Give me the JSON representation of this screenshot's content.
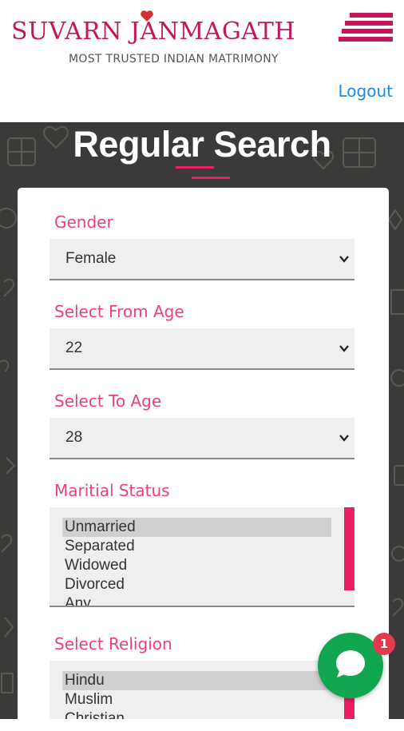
{
  "header": {
    "logo_text": "SUVARN JANMAGATH",
    "tagline": "MOST TRUSTED INDIAN MATRIMONY",
    "logout_label": "Logout"
  },
  "page": {
    "title": "Regular Search"
  },
  "form": {
    "gender": {
      "label": "Gender",
      "value": "Female"
    },
    "from_age": {
      "label": "Select From Age",
      "value": "22"
    },
    "to_age": {
      "label": "Select To Age",
      "value": "28"
    },
    "marital_status": {
      "label": "Maritial Status",
      "options": [
        "Unmarried",
        "Separated",
        "Widowed",
        "Divorced",
        "Any"
      ],
      "selected": "Unmarried"
    },
    "religion": {
      "label": "Select Religion",
      "options": [
        "Hindu",
        "Muslim",
        "Christian"
      ],
      "selected": "Hindu"
    }
  },
  "chat": {
    "badge_count": "1"
  },
  "colors": {
    "brand": "#c2185b",
    "label_pink": "#ec407a",
    "link_blue": "#1e88e5",
    "chat_green": "#13a651",
    "badge_red": "#e53950",
    "scroll_thumb": "#e91e63",
    "background_band": "#3b3a38"
  },
  "icons": {
    "logo_heart": "heart-icon",
    "logo_stripes": "stripes-icon",
    "select_chevron": "chevron-down-icon",
    "chat": "chat-bubble-icon"
  }
}
